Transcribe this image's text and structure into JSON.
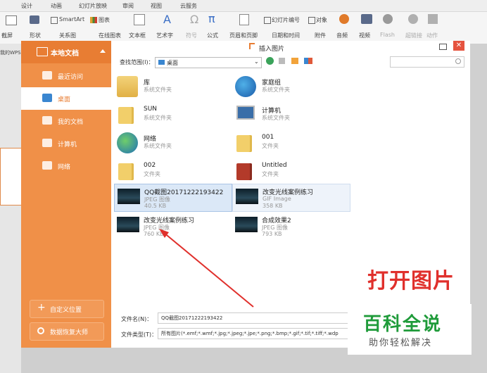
{
  "ribbon": {
    "tabs": [
      "设计",
      "动画",
      "幻灯片放映",
      "审阅",
      "视图",
      "云服务"
    ],
    "row1": {
      "smartart": "SmartArt",
      "chart": "图表",
      "slide_number": "幻灯片编号",
      "object": "对象"
    },
    "row2": {
      "screenshot": "截屏",
      "shape": "形状",
      "relation": "关系图",
      "online_chart": "在线图表",
      "textbox": "文本框",
      "arttext": "艺术字",
      "symbol": "符号",
      "formula": "公式",
      "header_footer": "页眉和页脚",
      "datetime": "日期和时间",
      "attachment": "附件",
      "audio": "音频",
      "video": "视频",
      "flash": "Flash",
      "hyperlink": "超链接",
      "action": "动作"
    },
    "glyph_A": "A",
    "glyph_omega": "Ω",
    "glyph_pi": "π"
  },
  "doc_tab_label": "我的WPS",
  "sidebar": {
    "header": "本地文档",
    "items": [
      {
        "label": "最近访问",
        "icon": "recent-icon"
      },
      {
        "label": "桌面",
        "icon": "desktop-icon",
        "selected": true
      },
      {
        "label": "我的文档",
        "icon": "my-documents-icon"
      },
      {
        "label": "计算机",
        "icon": "computer-icon"
      },
      {
        "label": "网络",
        "icon": "network-icon"
      }
    ],
    "custom_location": "自定义位置",
    "data_recovery": "数据恢复大师"
  },
  "dialog": {
    "title": "插入图片",
    "range_label": "查找范围(I)：",
    "range_value": "桌面",
    "items": [
      {
        "name": "库",
        "sub": "系统文件夹",
        "icon": "library-icon"
      },
      {
        "name": "家庭组",
        "sub": "系统文件夹",
        "icon": "homegroup-icon"
      },
      {
        "name": "SUN",
        "sub": "系统文件夹",
        "icon": "user-folder-icon"
      },
      {
        "name": "计算机",
        "sub": "系统文件夹",
        "icon": "computer-icon"
      },
      {
        "name": "网络",
        "sub": "系统文件夹",
        "icon": "network-icon"
      },
      {
        "name": "001",
        "sub": "文件夹",
        "icon": "folder-icon"
      },
      {
        "name": "002",
        "sub": "文件夹",
        "icon": "folder-icon"
      },
      {
        "name": "Untitled",
        "sub": "文件夹",
        "icon": "folder-icon"
      },
      {
        "name": "QQ截图20171222193422",
        "sub": "JPEG 图像",
        "size": "40.5 KB",
        "icon": "image-thumbnail",
        "selected": true
      },
      {
        "name": "改变光线案例练习",
        "sub": "GIF Image",
        "size": "358 KB",
        "icon": "image-thumbnail",
        "hover": true
      },
      {
        "name": "改变光线案例练习",
        "sub": "JPEG 图像",
        "size": "760 KB",
        "icon": "image-thumbnail"
      },
      {
        "name": "合成效果2",
        "sub": "JPEG 图像",
        "size": "793 KB",
        "icon": "image-thumbnail"
      }
    ],
    "filename_label": "文件名(N)：",
    "filename_value": "QQ截图20171222193422",
    "filetype_label": "文件类型(T)：",
    "filetype_value": "所有图片(*.emf;*.wmf;*.jpg;*.jpeg;*.jpe;*.png;*.bmp;*.gif;*.tif;*.tiff;*.wdp"
  },
  "annotation": "打开图片",
  "watermark": {
    "title": "百科全说",
    "subtitle": "助你轻松解决"
  },
  "colors": {
    "orange": "#f09048",
    "orange_dark": "#e87d33",
    "red_annotation": "#e0302c",
    "green_watermark": "#1f9b3a",
    "selection": "#dbe8f7"
  }
}
